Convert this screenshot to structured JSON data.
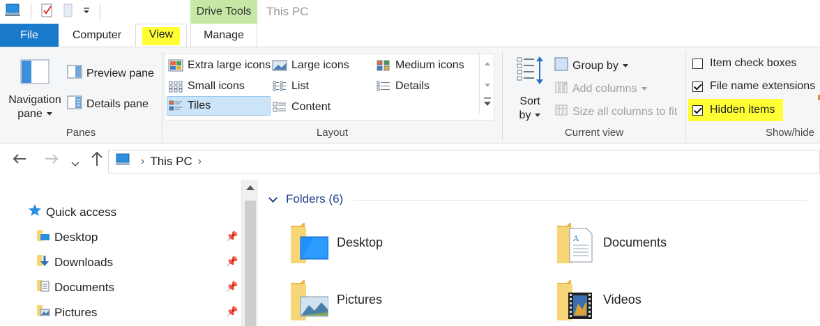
{
  "titlebar": {
    "context_tab": "Drive Tools",
    "title": "This PC"
  },
  "tabs": {
    "file": "File",
    "computer": "Computer",
    "view": "View",
    "manage": "Manage"
  },
  "ribbon": {
    "panes": {
      "navigation_pane": "Navigation",
      "navigation_pane_2": "pane",
      "preview_pane": "Preview pane",
      "details_pane": "Details pane",
      "label": "Panes"
    },
    "layout": {
      "items": [
        "Extra large icons",
        "Large icons",
        "Medium icons",
        "Small icons",
        "List",
        "Details",
        "Tiles",
        "Content"
      ],
      "selected": "Tiles",
      "label": "Layout"
    },
    "current_view": {
      "sort_by": "Sort",
      "sort_by_2": "by",
      "group_by": "Group by",
      "add_columns": "Add columns",
      "size_all": "Size all columns to fit",
      "label": "Current view"
    },
    "show_hide": {
      "item_check_boxes": "Item check boxes",
      "file_name_extensions": "File name extensions",
      "hidden_items": "Hidden items",
      "checks": {
        "item_check_boxes": false,
        "file_name_extensions": true,
        "hidden_items": true
      },
      "label": "Show/hide"
    }
  },
  "address": {
    "location": "This PC"
  },
  "navpane": {
    "quick_access": "Quick access",
    "items": [
      "Desktop",
      "Downloads",
      "Documents",
      "Pictures"
    ]
  },
  "content": {
    "section": "Folders (6)",
    "folders": [
      "Desktop",
      "Documents",
      "Pictures",
      "Videos"
    ]
  },
  "colors": {
    "file_tab": "#1979ca",
    "drive_tools": "#c5e8a6",
    "highlight": "#ffff33",
    "folder": "#f6d676",
    "section_header": "#1e3f8a"
  }
}
